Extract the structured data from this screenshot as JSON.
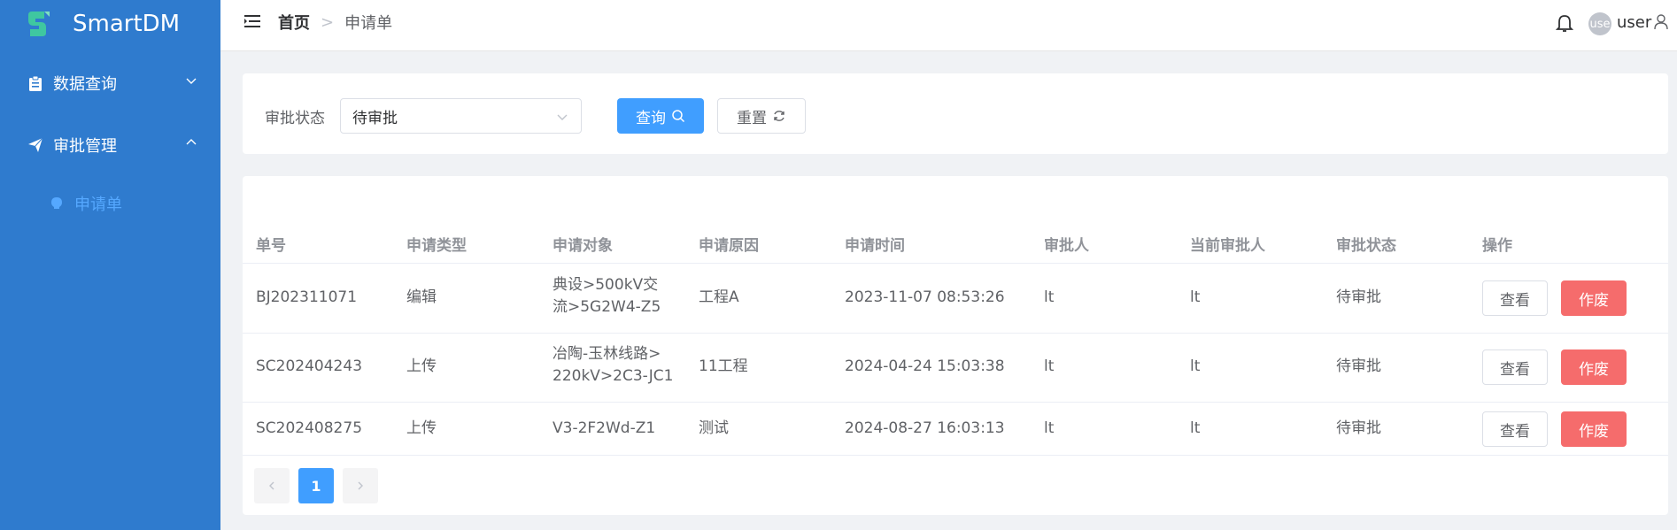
{
  "app": {
    "name": "SmartDM"
  },
  "sidebar": {
    "items": [
      {
        "label": "数据查询",
        "icon": "clipboard-icon",
        "expanded": false
      },
      {
        "label": "审批管理",
        "icon": "paper-plane-icon",
        "expanded": true
      }
    ],
    "sub_items": [
      {
        "label": "申请单",
        "icon": "bulb-icon",
        "active": true
      }
    ]
  },
  "header": {
    "breadcrumb": {
      "home": "首页",
      "current": "申请单"
    },
    "avatar_text": "use",
    "user_name": "user"
  },
  "filter": {
    "status_label": "审批状态",
    "status_value": "待审批",
    "search_label": "查询",
    "reset_label": "重置"
  },
  "table": {
    "columns": [
      "单号",
      "申请类型",
      "申请对象",
      "申请原因",
      "申请时间",
      "审批人",
      "当前审批人",
      "审批状态",
      "操作"
    ],
    "rows": [
      {
        "id": "BJ202311071",
        "type": "编辑",
        "target_line1": "典设>500kV交",
        "target_line2": "流>5G2W4-Z5",
        "reason": "工程A",
        "time": "2023-11-07 08:53:26",
        "approver": "lt",
        "current_approver": "lt",
        "status": "待审批",
        "view_label": "查看",
        "void_label": "作废"
      },
      {
        "id": "SC202404243",
        "type": "上传",
        "target_line1": "冶陶-玉林线路>",
        "target_line2": "220kV>2C3-JC1",
        "reason": "11工程",
        "time": "2024-04-24 15:03:38",
        "approver": "lt",
        "current_approver": "lt",
        "status": "待审批",
        "view_label": "查看",
        "void_label": "作废"
      },
      {
        "id": "SC202408275",
        "type": "上传",
        "target_line1": "V3-2F2Wd-Z1",
        "target_line2": "",
        "reason": "测试",
        "time": "2024-08-27 16:03:13",
        "approver": "lt",
        "current_approver": "lt",
        "status": "待审批",
        "view_label": "查看",
        "void_label": "作废"
      }
    ]
  },
  "pagination": {
    "current_page": "1"
  },
  "colors": {
    "sidebar_bg": "#2f7bce",
    "primary": "#409eff",
    "danger": "#f56c6c",
    "active_sub": "#55a8ff"
  }
}
